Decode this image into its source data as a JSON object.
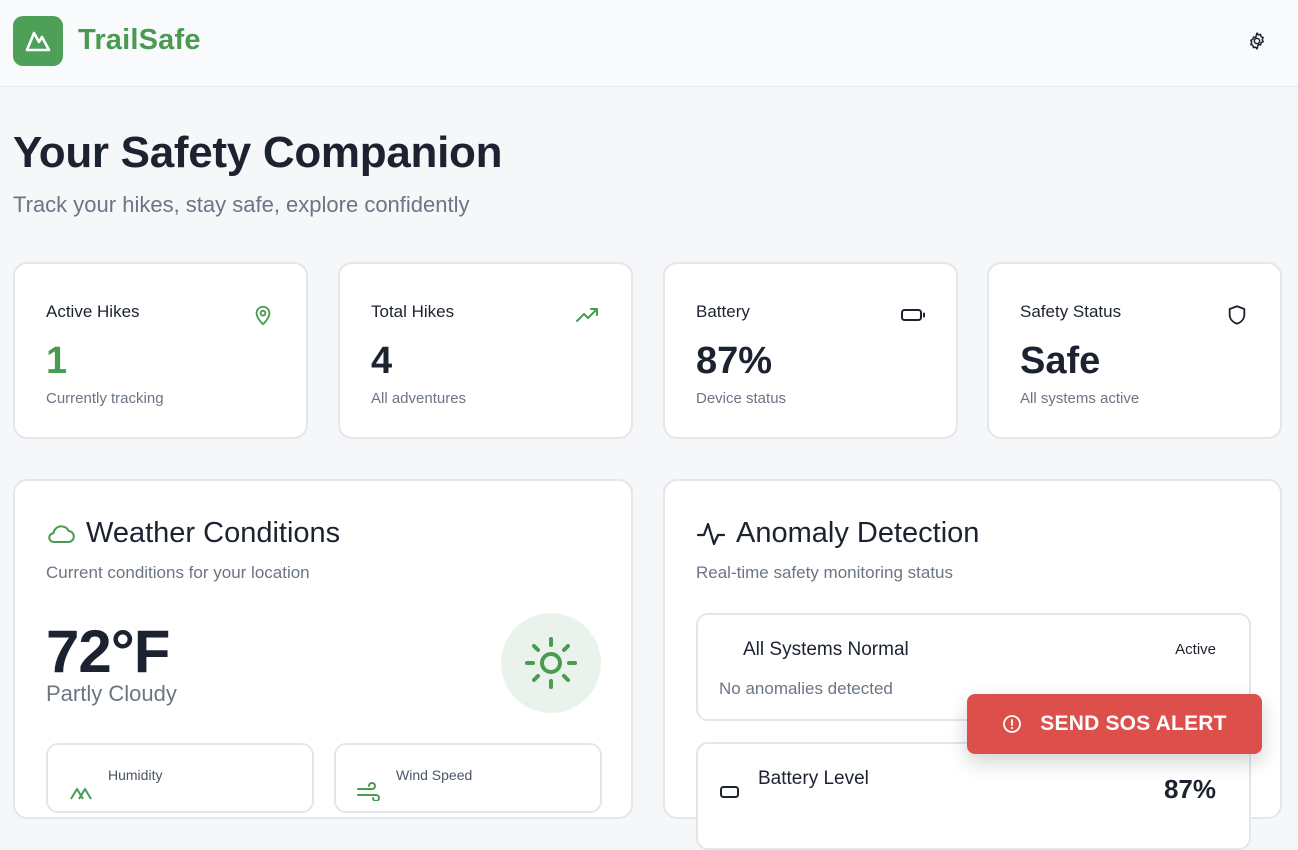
{
  "app": {
    "name": "TrailSafe"
  },
  "hero": {
    "title": "Your Safety Companion",
    "subtitle": "Track your hikes, stay safe, explore confidently"
  },
  "stats": [
    {
      "label": "Active Hikes",
      "value": "1",
      "desc": "Currently tracking",
      "icon": "map-pin-icon"
    },
    {
      "label": "Total Hikes",
      "value": "4",
      "desc": "All adventures",
      "icon": "trending-up-icon"
    },
    {
      "label": "Battery",
      "value": "87%",
      "desc": "Device status",
      "icon": "battery-icon"
    },
    {
      "label": "Safety Status",
      "value": "Safe",
      "desc": "All systems active",
      "icon": "shield-icon"
    }
  ],
  "weather": {
    "title": "Weather Conditions",
    "subtitle": "Current conditions for your location",
    "temperature": "72°F",
    "condition": "Partly Cloudy",
    "humidity_label": "Humidity",
    "wind_label": "Wind Speed"
  },
  "anomaly": {
    "title": "Anomaly Detection",
    "subtitle": "Real-time safety monitoring status",
    "items": [
      {
        "title": "All Systems Normal",
        "badge": "Active",
        "desc": "No anomalies detected"
      },
      {
        "title": "Battery Level",
        "value": "87%"
      }
    ]
  },
  "sos": {
    "label": "SEND SOS ALERT"
  },
  "colors": {
    "brand": "#4e9f57",
    "sos": "#dc4f4a"
  }
}
